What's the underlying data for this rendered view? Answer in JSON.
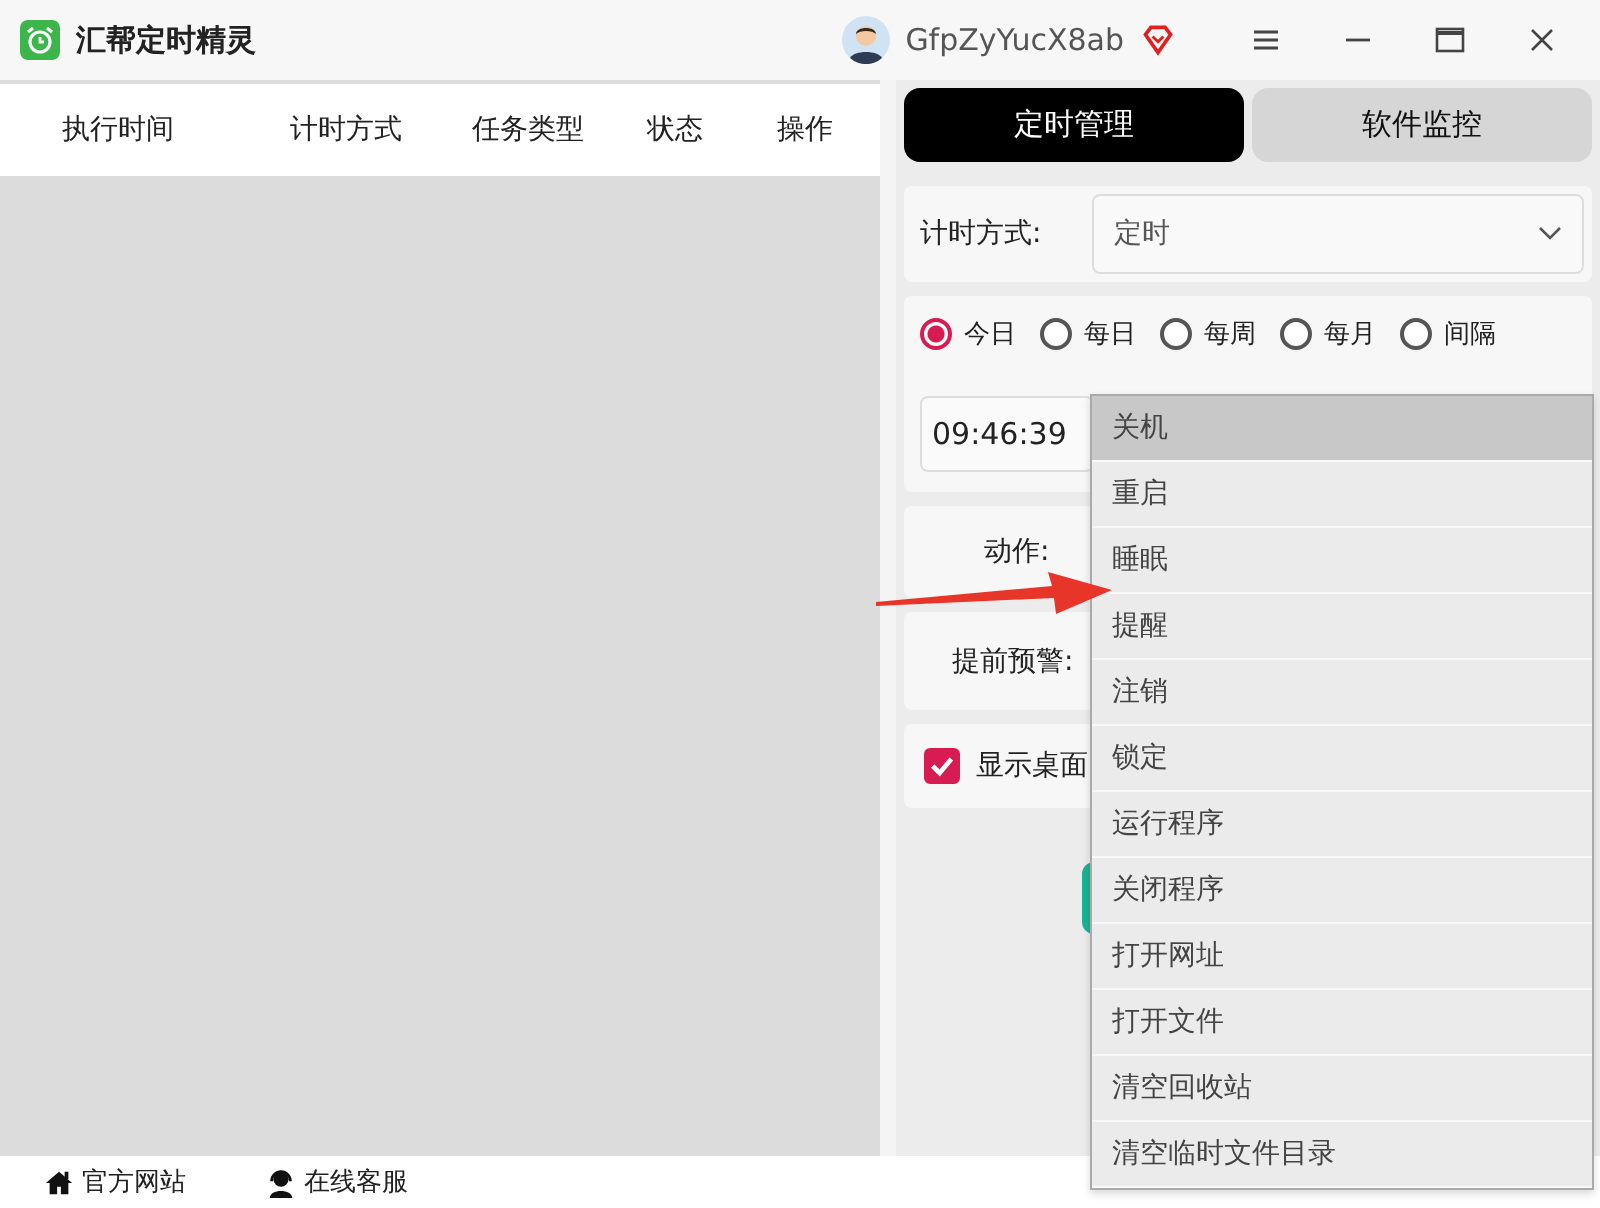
{
  "app": {
    "title": "汇帮定时精灵",
    "username": "GfpZyYucX8ab"
  },
  "table": {
    "columns": [
      "执行时间",
      "计时方式",
      "任务类型",
      "状态",
      "操作"
    ]
  },
  "tabs": [
    {
      "label": "定时管理",
      "selected": true
    },
    {
      "label": "软件监控",
      "selected": false
    }
  ],
  "timing": {
    "label": "计时方式:",
    "value": "定时"
  },
  "frequency": [
    {
      "label": "今日",
      "selected": true
    },
    {
      "label": "每日",
      "selected": false
    },
    {
      "label": "每周",
      "selected": false
    },
    {
      "label": "每月",
      "selected": false
    },
    {
      "label": "间隔",
      "selected": false
    }
  ],
  "time_value": "09:46:39",
  "action": {
    "label": "动作:"
  },
  "warning": {
    "label": "提前预警:"
  },
  "desktop_option": {
    "label": "显示桌面",
    "checked": true
  },
  "dropdown": [
    {
      "label": "关机",
      "selected": true
    },
    {
      "label": "重启",
      "selected": false
    },
    {
      "label": "睡眠",
      "selected": false
    },
    {
      "label": "提醒",
      "selected": false
    },
    {
      "label": "注销",
      "selected": false
    },
    {
      "label": "锁定",
      "selected": false
    },
    {
      "label": "运行程序",
      "selected": false
    },
    {
      "label": "关闭程序",
      "selected": false
    },
    {
      "label": "打开网址",
      "selected": false
    },
    {
      "label": "打开文件",
      "selected": false
    },
    {
      "label": "清空回收站",
      "selected": false
    },
    {
      "label": "清空临时文件目录",
      "selected": false
    }
  ],
  "footer": [
    {
      "kind": "home",
      "label": "官方网站"
    },
    {
      "kind": "support",
      "label": "在线客服"
    }
  ]
}
